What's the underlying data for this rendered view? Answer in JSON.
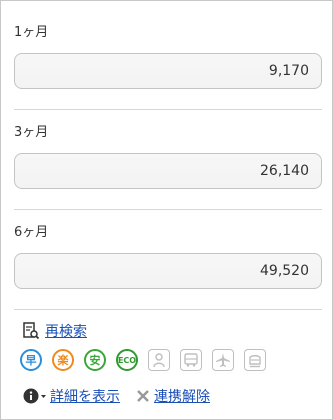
{
  "periods": [
    {
      "label": "1ヶ月",
      "price": "9,170"
    },
    {
      "label": "3ヶ月",
      "price": "26,140"
    },
    {
      "label": "6ヶ月",
      "price": "49,520"
    }
  ],
  "research": {
    "link_label": "再検索",
    "icon": "search-document-icon"
  },
  "route_icons": [
    {
      "name": "fastest-icon",
      "text": "早",
      "color": "#2a8fd8"
    },
    {
      "name": "cheapest-icon",
      "text": "楽",
      "color": "#f08a1c"
    },
    {
      "name": "safest-icon",
      "text": "安",
      "color": "#3aa63a"
    },
    {
      "name": "eco-icon",
      "text": "ECO",
      "color": "#2f9a2f"
    },
    {
      "name": "person-icon",
      "color": "#bfbfbf"
    },
    {
      "name": "bus-icon",
      "color": "#bfbfbf"
    },
    {
      "name": "airplane-icon",
      "color": "#bfbfbf"
    },
    {
      "name": "shinkansen-icon",
      "color": "#bfbfbf"
    }
  ],
  "actions": {
    "details_label": "詳細を表示",
    "details_icon": "info-icon",
    "unlink_label": "連携解除",
    "unlink_icon": "close-icon"
  }
}
